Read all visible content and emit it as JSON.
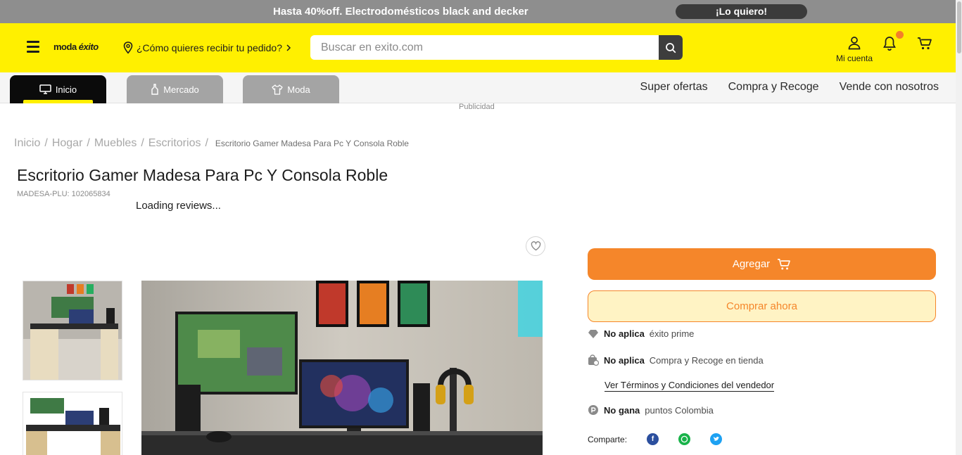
{
  "promo": {
    "text": "Hasta 40%off. Electrodomésticos black and decker",
    "cta": "¡Lo quiero!"
  },
  "header": {
    "logo_prefix": "moda",
    "logo_brand": "éxito",
    "delivery_text": "¿Cómo quieres recibir tu pedido?",
    "search_placeholder": "Buscar en exito.com",
    "account_label": "Mi cuenta"
  },
  "nav": {
    "tabs": [
      {
        "label": "Inicio",
        "active": true,
        "icon": "monitor-icon"
      },
      {
        "label": "Mercado",
        "active": false,
        "icon": "bottle-icon"
      },
      {
        "label": "Moda",
        "active": false,
        "icon": "shirt-icon"
      }
    ],
    "links": [
      "Super ofertas",
      "Compra y Recoge",
      "Vende con nosotros"
    ]
  },
  "ad_label": "Publicidad",
  "breadcrumb": [
    "Inicio",
    "Hogar",
    "Muebles",
    "Escritorios",
    "Escritorio Gamer Madesa Para Pc Y Consola Roble"
  ],
  "product": {
    "title": "Escritorio Gamer Madesa Para Pc Y Consola Roble",
    "sku": "MADESA-PLU: 102065834",
    "reviews": "Loading reviews..."
  },
  "actions": {
    "add_label": "Agregar",
    "buy_label": "Comprar ahora"
  },
  "info": {
    "prime_strong": "No aplica",
    "prime_text": "éxito prime",
    "pickup_strong": "No aplica",
    "pickup_text": "Compra y Recoge en tienda",
    "terms": "Ver Términos y Condiciones del vendedor",
    "points_strong": "No gana",
    "points_text": "puntos Colombia",
    "share_label": "Comparte:"
  },
  "colors": {
    "brand_yellow": "#fff000",
    "accent_orange": "#f5862a",
    "dark": "#0b0b0b"
  }
}
